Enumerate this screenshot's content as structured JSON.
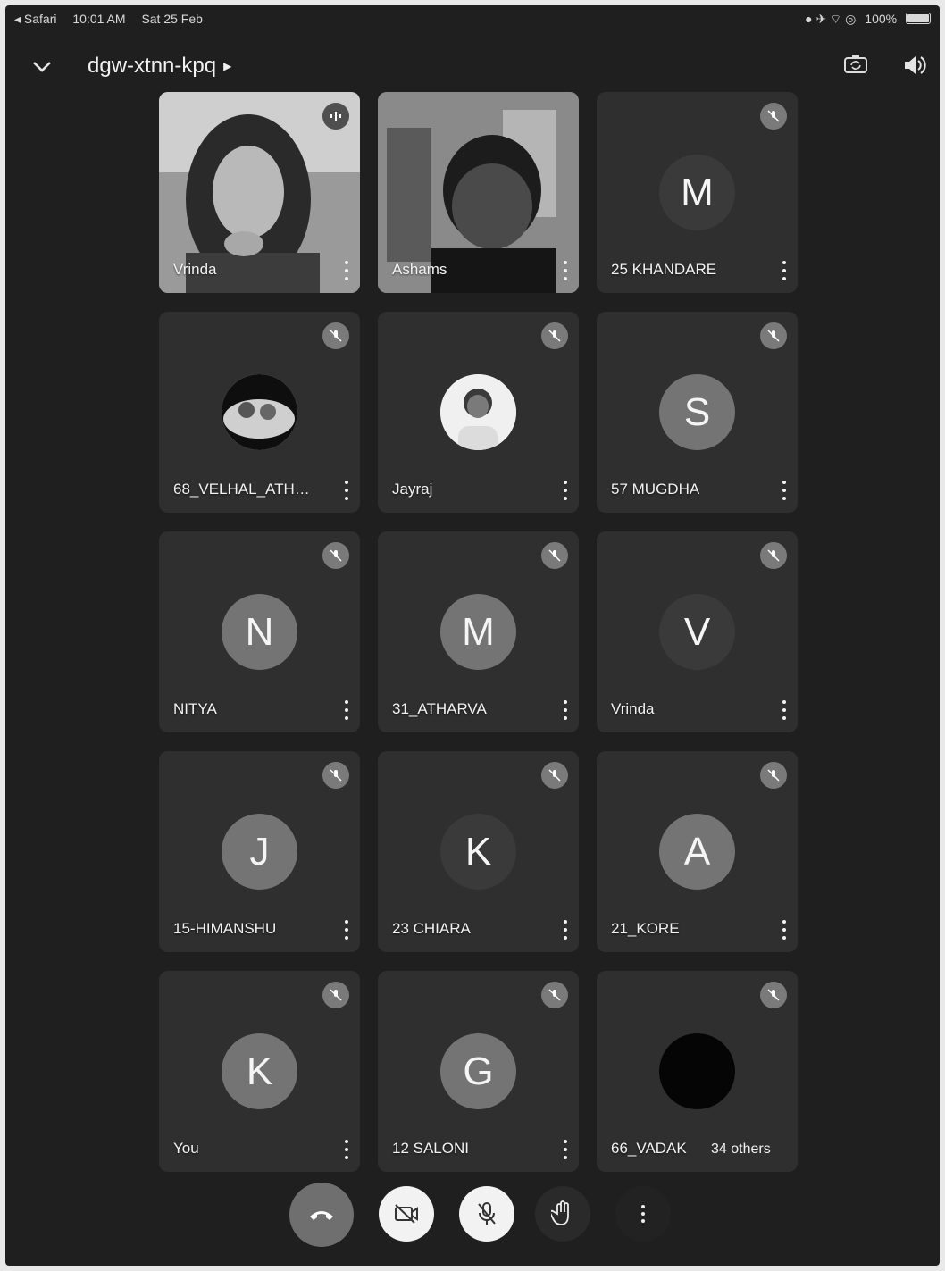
{
  "status_bar": {
    "back_app": "◂ Safari",
    "time": "10:01 AM",
    "date": "Sat 25 Feb",
    "battery": "100%"
  },
  "header": {
    "meeting_code": "dgw-xtnn-kpq"
  },
  "tiles": [
    {
      "name": "Vrinda",
      "type": "video",
      "mic": "active"
    },
    {
      "name": "Ashams",
      "type": "video",
      "mic": "none"
    },
    {
      "name": "25 KHANDARE",
      "type": "initial",
      "initial": "M",
      "mic": "muted"
    },
    {
      "name": "68_VELHAL_ATHA...",
      "type": "photo",
      "mic": "muted"
    },
    {
      "name": "Jayraj",
      "type": "photo",
      "mic": "muted"
    },
    {
      "name": "57 MUGDHA",
      "type": "initial",
      "initial": "S",
      "mic": "muted"
    },
    {
      "name": "NITYA",
      "type": "initial",
      "initial": "N",
      "mic": "muted"
    },
    {
      "name": "31_ATHARVA",
      "type": "initial",
      "initial": "M",
      "mic": "muted"
    },
    {
      "name": "Vrinda",
      "type": "initial",
      "initial": "V",
      "mic": "muted"
    },
    {
      "name": "15-HIMANSHU",
      "type": "initial",
      "initial": "J",
      "mic": "muted"
    },
    {
      "name": "23 CHIARA",
      "type": "initial",
      "initial": "K",
      "mic": "muted"
    },
    {
      "name": "21_KORE",
      "type": "initial",
      "initial": "A",
      "mic": "muted"
    },
    {
      "name": "You",
      "type": "initial",
      "initial": "K",
      "mic": "muted"
    },
    {
      "name": "12 SALONI",
      "type": "initial",
      "initial": "G",
      "mic": "muted"
    },
    {
      "name": "66_VADAK",
      "type": "others",
      "others_label": "34 others",
      "mic": "muted"
    }
  ],
  "controls": {
    "end_call": "end-call",
    "camera": "camera-off",
    "microphone": "mic-off",
    "raise_hand": "raise-hand",
    "more": "more-options"
  }
}
